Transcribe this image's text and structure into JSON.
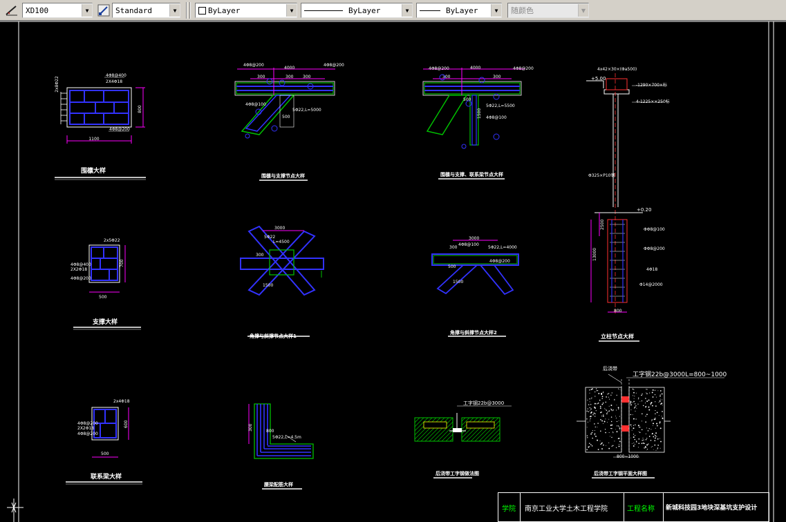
{
  "toolbar": {
    "dimstyle": "XD100",
    "textstyle": "Standard",
    "layer": "ByLayer",
    "linetype": "ByLayer",
    "lineweight": "ByLayer",
    "plotstyle": "随颜色"
  },
  "details": {
    "d1": {
      "title": "围檩大样",
      "dims": [
        "1100",
        "800"
      ],
      "notes": [
        "2x8Φ22",
        "4Φ8@400",
        "2X4Φ18",
        "4Φ8@200"
      ]
    },
    "d2": {
      "title": "围檩与支撑节点大样",
      "dims": [
        "4000",
        "300",
        "300",
        "300",
        "500"
      ],
      "notes": [
        "4Φ8@200",
        "4Φ8@100",
        "5Φ22,L=5000",
        "4Φ8@200"
      ]
    },
    "d3": {
      "title": "围檩与支撑、联系梁节点大样",
      "dims": [
        "4000",
        "300",
        "300",
        "500",
        "1500"
      ],
      "notes": [
        "4Φ8@200",
        "5Φ22,L=5500",
        "4Φ8@100",
        "4Φ8@200"
      ]
    },
    "d4": {
      "title": "立柱节点大样",
      "dims": [
        "+5.00",
        "800",
        "2500",
        "13000",
        "+0.20"
      ],
      "notes": [
        "4x42×30×(Φa500)",
        "-1290×700×标",
        "4-1225××250标",
        "Φ325×P10钢",
        "ΦΦ8@100",
        "ΦΦ8@200",
        "4Φ18",
        "Φ14@2000"
      ]
    },
    "d5": {
      "title": "支撑大样",
      "dims": [
        "500",
        "700"
      ],
      "notes": [
        "2x5Φ22",
        "4Φ8@400",
        "2X2Φ18",
        "4Φ8@200"
      ]
    },
    "d6": {
      "title": "角撑与斜撑节点大样1",
      "dims": [
        "3000",
        "1500",
        "300"
      ],
      "notes": [
        "5Φ22",
        "L=4500"
      ]
    },
    "d7": {
      "title": "角撑与斜撑节点大样2",
      "dims": [
        "3000",
        "1500",
        "300",
        "500"
      ],
      "notes": [
        "4Φ8@100",
        "5Φ22,L=4000",
        "4Φ8@200"
      ]
    },
    "d8": {
      "title": "联系梁大样",
      "dims": [
        "500",
        "600"
      ],
      "notes": [
        "2x4Φ18",
        "4Φ8@200",
        "2X2Φ18",
        "4Φ8@200"
      ]
    },
    "d9": {
      "title": "腰梁配筋大样",
      "dims": [
        "300",
        "800"
      ],
      "notes": [
        "5Φ22,L=4.5m"
      ]
    },
    "d10": {
      "title": "后浇带工字钢做法图",
      "dims": [],
      "notes": [
        "工字钢22b@3000"
      ]
    },
    "d11": {
      "title": "后浇带工字钢平面大样图",
      "dims": [
        "800~1000"
      ],
      "notes": [
        "后浇带",
        "工字钢22b@3000L=800~1000"
      ]
    }
  },
  "title_block": {
    "label1": "学院",
    "value1": "南京工业大学土木工程学院",
    "label2": "工程名称",
    "value2": "新城科技园3地块深基坑支护设计"
  },
  "colors": {
    "bg": "#000000",
    "text": "#ffffff",
    "rebar": "#3232ff",
    "dim": "#ff00ff",
    "concrete": "#00cc00",
    "tag": "#ffff00",
    "label": "#00ff00"
  }
}
